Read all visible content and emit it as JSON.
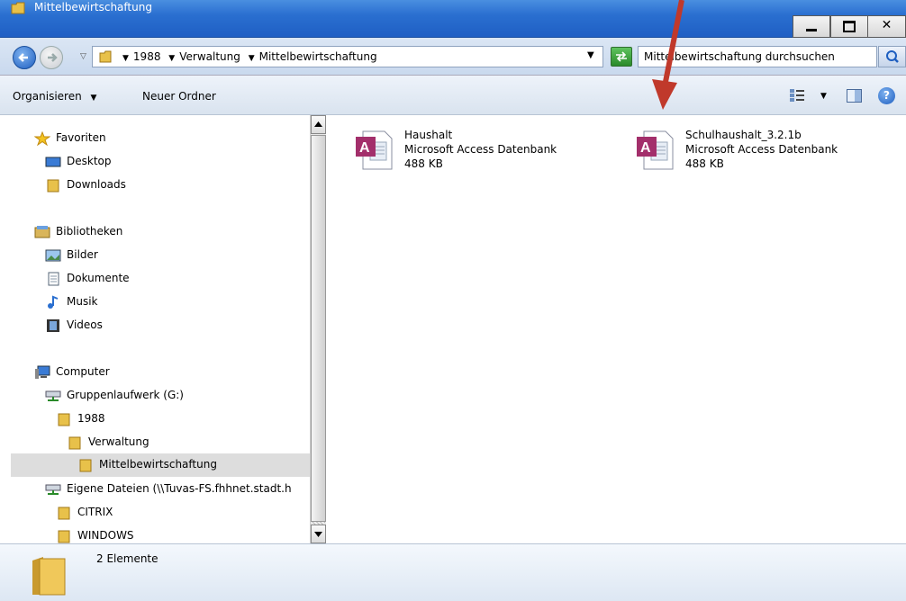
{
  "window": {
    "title": "Mittelbewirtschaftung"
  },
  "address": {
    "crumbs": [
      "1988",
      "Verwaltung",
      "Mittelbewirtschaftung"
    ]
  },
  "search": {
    "placeholder": "Mittelbewirtschaftung durchsuchen"
  },
  "toolbar": {
    "organize_label": "Organisieren",
    "new_folder_label": "Neuer Ordner"
  },
  "nav": {
    "favorites": {
      "label": "Favoriten",
      "items": [
        {
          "label": "Desktop"
        },
        {
          "label": "Downloads"
        }
      ]
    },
    "libraries": {
      "label": "Bibliotheken",
      "items": [
        {
          "label": "Bilder"
        },
        {
          "label": "Dokumente"
        },
        {
          "label": "Musik"
        },
        {
          "label": "Videos"
        }
      ]
    },
    "computer": {
      "label": "Computer",
      "drive": "Gruppenlaufwerk (G:)",
      "tree": [
        {
          "label": "1988"
        },
        {
          "label": "Verwaltung"
        },
        {
          "label": "Mittelbewirtschaftung"
        }
      ],
      "network_drive": "Eigene Dateien (\\\\Tuvas-FS.fhhnet.stadt.h",
      "network_items": [
        {
          "label": "CITRIX"
        },
        {
          "label": "WINDOWS"
        }
      ]
    }
  },
  "files": [
    {
      "name": "Haushalt",
      "type": "Microsoft Access Datenbank",
      "size": "488 KB"
    },
    {
      "name": "Schulhaushalt_3.2.1b",
      "type": "Microsoft Access Datenbank",
      "size": "488 KB"
    }
  ],
  "status": {
    "count_text": "2 Elemente"
  },
  "colors": {
    "title_bar": "#2a6fd0",
    "annotation_arrow": "#c0392b",
    "selection": "#dddddd"
  }
}
